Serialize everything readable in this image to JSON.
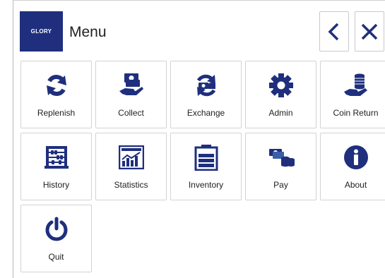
{
  "header": {
    "logo_text": "GLORY",
    "title": "Menu"
  },
  "nav": {
    "back_icon": "chevron-left-icon",
    "close_icon": "close-icon"
  },
  "colors": {
    "brand": "#1f2f7d",
    "icon": "#1f2f7d",
    "money": "#3a5fa8"
  },
  "tiles": [
    {
      "label": "Replenish",
      "icon": "refresh-icon"
    },
    {
      "label": "Collect",
      "icon": "hand-money-icon"
    },
    {
      "label": "Exchange",
      "icon": "exchange-icon"
    },
    {
      "label": "Admin",
      "icon": "gear-icon"
    },
    {
      "label": "Coin Return",
      "icon": "coin-return-icon"
    },
    {
      "label": "History",
      "icon": "abacus-icon"
    },
    {
      "label": "Statistics",
      "icon": "chart-icon"
    },
    {
      "label": "Inventory",
      "icon": "battery-icon"
    },
    {
      "label": "Pay",
      "icon": "pay-icon"
    },
    {
      "label": "About",
      "icon": "info-icon"
    },
    {
      "label": "Quit",
      "icon": "power-icon"
    }
  ]
}
